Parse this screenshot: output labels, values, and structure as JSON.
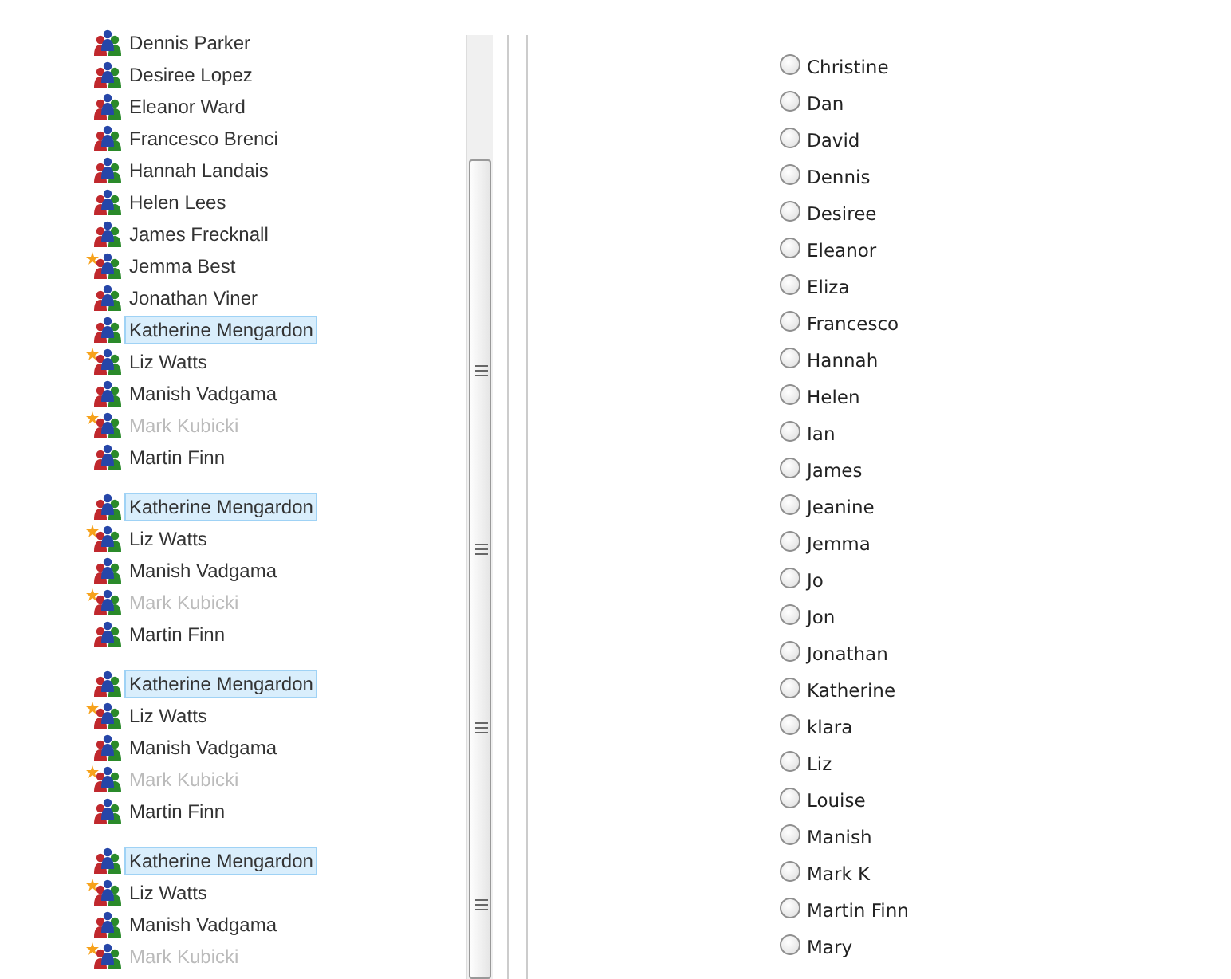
{
  "tree_segments": [
    {
      "items": [
        {
          "name": "Dennis Parker",
          "starred": false,
          "selected": false,
          "disabled": false
        },
        {
          "name": "Desiree Lopez",
          "starred": false,
          "selected": false,
          "disabled": false
        },
        {
          "name": "Eleanor Ward",
          "starred": false,
          "selected": false,
          "disabled": false
        },
        {
          "name": "Francesco Brenci",
          "starred": false,
          "selected": false,
          "disabled": false
        },
        {
          "name": "Hannah Landais",
          "starred": false,
          "selected": false,
          "disabled": false
        },
        {
          "name": "Helen Lees",
          "starred": false,
          "selected": false,
          "disabled": false
        },
        {
          "name": "James Frecknall",
          "starred": false,
          "selected": false,
          "disabled": false
        },
        {
          "name": "Jemma Best",
          "starred": true,
          "selected": false,
          "disabled": false
        },
        {
          "name": "Jonathan Viner",
          "starred": false,
          "selected": false,
          "disabled": false
        },
        {
          "name": "Katherine Mengardon",
          "starred": false,
          "selected": true,
          "disabled": false
        },
        {
          "name": "Liz Watts",
          "starred": true,
          "selected": false,
          "disabled": false
        },
        {
          "name": "Manish Vadgama",
          "starred": false,
          "selected": false,
          "disabled": false
        },
        {
          "name": "Mark Kubicki",
          "starred": true,
          "selected": false,
          "disabled": true
        },
        {
          "name": "Martin Finn",
          "starred": false,
          "selected": false,
          "disabled": false
        }
      ]
    },
    {
      "items": [
        {
          "name": "Katherine Mengardon",
          "starred": false,
          "selected": true,
          "disabled": false
        },
        {
          "name": "Liz Watts",
          "starred": true,
          "selected": false,
          "disabled": false
        },
        {
          "name": "Manish Vadgama",
          "starred": false,
          "selected": false,
          "disabled": false
        },
        {
          "name": "Mark Kubicki",
          "starred": true,
          "selected": false,
          "disabled": true
        },
        {
          "name": "Martin Finn",
          "starred": false,
          "selected": false,
          "disabled": false
        }
      ]
    },
    {
      "items": [
        {
          "name": "Katherine Mengardon",
          "starred": false,
          "selected": true,
          "disabled": false
        },
        {
          "name": "Liz Watts",
          "starred": true,
          "selected": false,
          "disabled": false
        },
        {
          "name": "Manish Vadgama",
          "starred": false,
          "selected": false,
          "disabled": false
        },
        {
          "name": "Mark Kubicki",
          "starred": true,
          "selected": false,
          "disabled": true
        },
        {
          "name": "Martin Finn",
          "starred": false,
          "selected": false,
          "disabled": false
        }
      ]
    },
    {
      "items": [
        {
          "name": "Katherine Mengardon",
          "starred": false,
          "selected": true,
          "disabled": false
        },
        {
          "name": "Liz Watts",
          "starred": true,
          "selected": false,
          "disabled": false
        },
        {
          "name": "Manish Vadgama",
          "starred": false,
          "selected": false,
          "disabled": false
        },
        {
          "name": "Mark Kubicki",
          "starred": true,
          "selected": false,
          "disabled": true
        }
      ]
    }
  ],
  "radio_options": [
    {
      "label": "Christine",
      "selected": false
    },
    {
      "label": "Dan",
      "selected": false
    },
    {
      "label": "David",
      "selected": false
    },
    {
      "label": "Dennis",
      "selected": false
    },
    {
      "label": "Desiree",
      "selected": false
    },
    {
      "label": "Eleanor",
      "selected": false
    },
    {
      "label": "Eliza",
      "selected": false
    },
    {
      "label": "Francesco",
      "selected": false
    },
    {
      "label": "Hannah",
      "selected": false
    },
    {
      "label": "Helen",
      "selected": false
    },
    {
      "label": "Ian",
      "selected": false
    },
    {
      "label": "James",
      "selected": false
    },
    {
      "label": "Jeanine",
      "selected": false
    },
    {
      "label": "Jemma",
      "selected": false
    },
    {
      "label": "Jo",
      "selected": false
    },
    {
      "label": "Jon",
      "selected": false
    },
    {
      "label": "Jonathan",
      "selected": false
    },
    {
      "label": "Katherine",
      "selected": false
    },
    {
      "label": "klara",
      "selected": false
    },
    {
      "label": "Liz",
      "selected": false
    },
    {
      "label": "Louise",
      "selected": false
    },
    {
      "label": "Manish",
      "selected": false
    },
    {
      "label": "Mark K",
      "selected": false
    },
    {
      "label": "Martin Finn",
      "selected": false
    },
    {
      "label": "Mary",
      "selected": false
    }
  ]
}
